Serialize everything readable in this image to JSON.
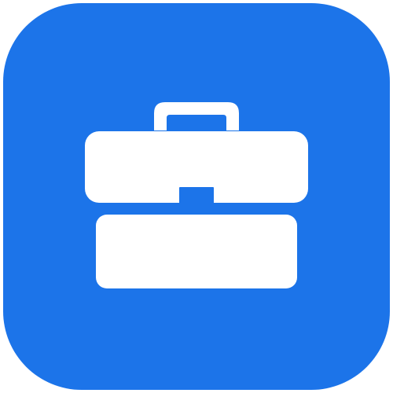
{
  "app_icon": {
    "background_color": "#1c74e9",
    "glyph_color": "#ffffff",
    "glyph": "briefcase-icon"
  }
}
